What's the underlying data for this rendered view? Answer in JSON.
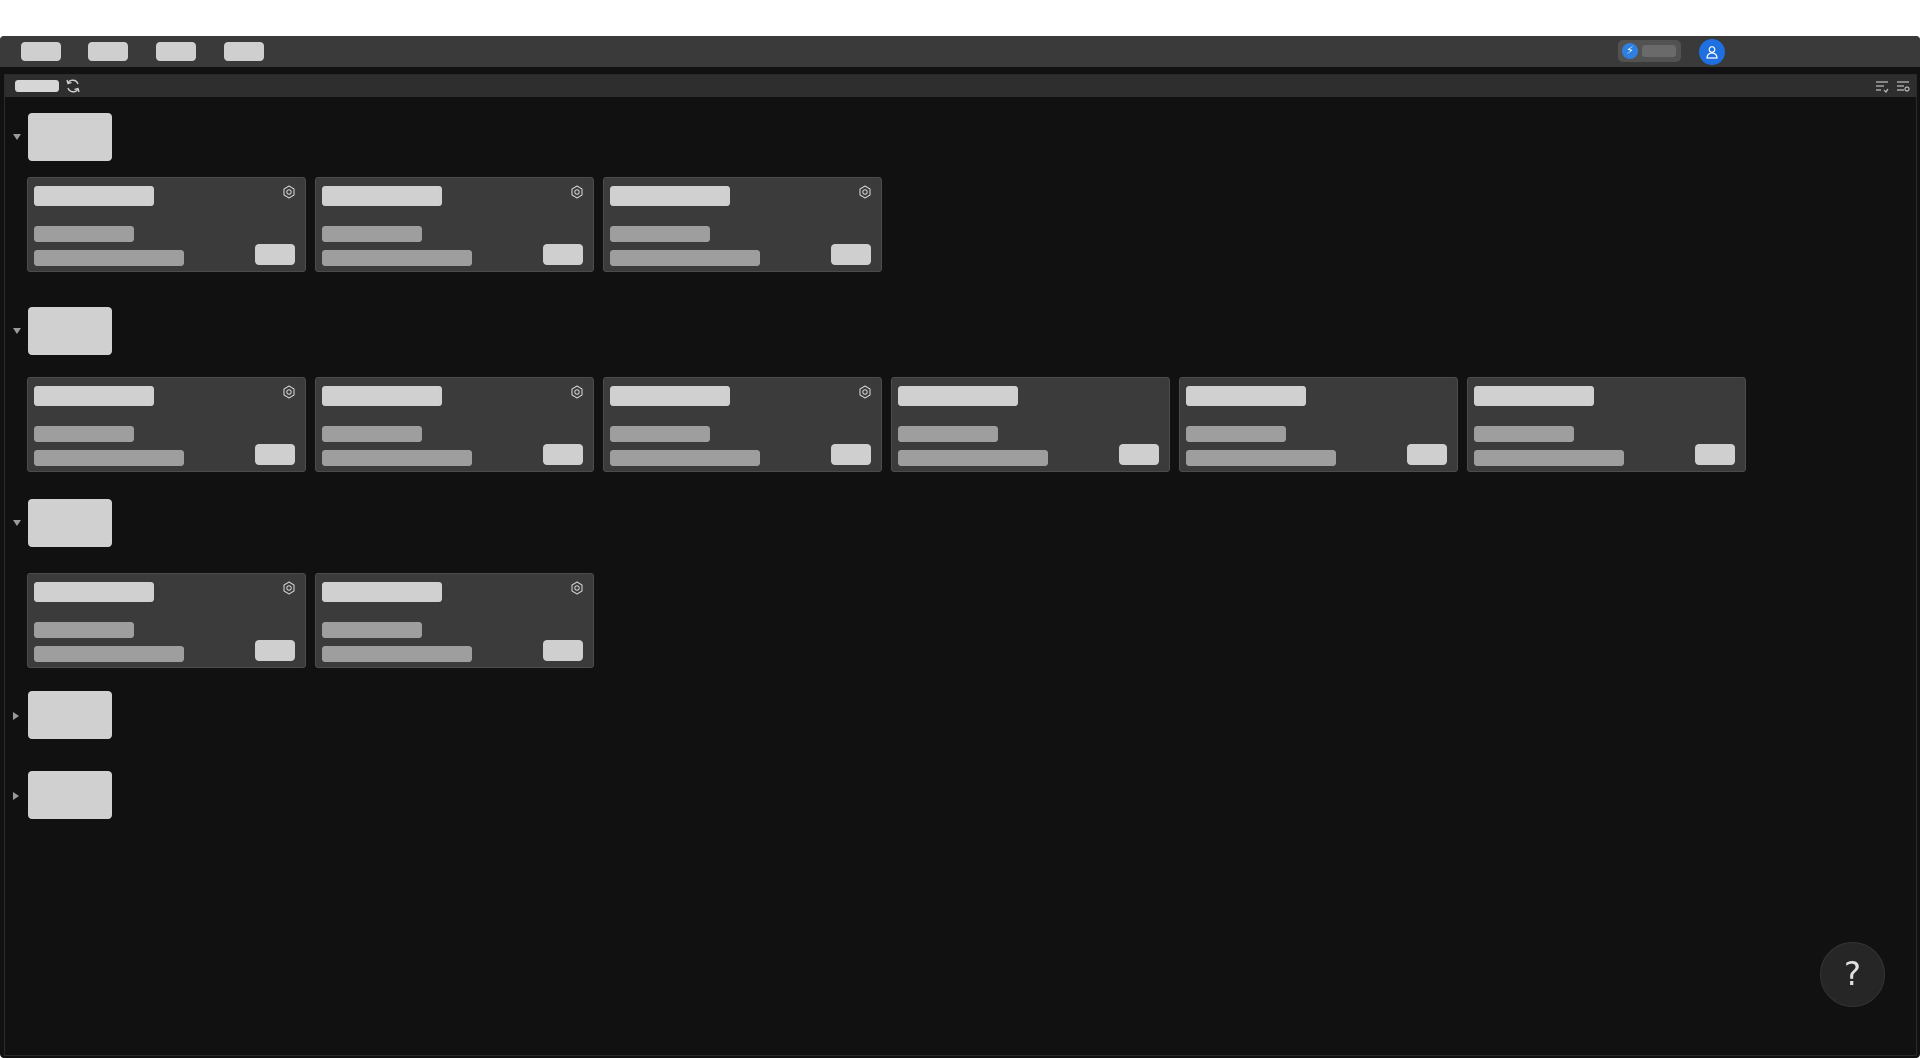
{
  "topbar": {
    "nav_items": [
      "",
      "",
      "",
      ""
    ],
    "speed_icon_name": "speed-icon",
    "avatar_icon_name": "user-icon",
    "accent_color": "#1f6fe0"
  },
  "subbar": {
    "breadcrumb": "",
    "icons": [
      "refresh-icon",
      "filter-list-icon",
      "filter-settings-icon"
    ]
  },
  "groups": [
    {
      "expanded": true,
      "label": "",
      "cards": [
        {
          "title": "",
          "subtitle": "",
          "desc": "",
          "button": "",
          "has_gear": true
        },
        {
          "title": "",
          "subtitle": "",
          "desc": "",
          "button": "",
          "has_gear": true
        },
        {
          "title": "",
          "subtitle": "",
          "desc": "",
          "button": "",
          "has_gear": true
        }
      ]
    },
    {
      "expanded": true,
      "label": "",
      "cards": [
        {
          "title": "",
          "subtitle": "",
          "desc": "",
          "button": "",
          "has_gear": true
        },
        {
          "title": "",
          "subtitle": "",
          "desc": "",
          "button": "",
          "has_gear": true
        },
        {
          "title": "",
          "subtitle": "",
          "desc": "",
          "button": "",
          "has_gear": true
        },
        {
          "title": "",
          "subtitle": "",
          "desc": "",
          "button": "",
          "has_gear": false
        },
        {
          "title": "",
          "subtitle": "",
          "desc": "",
          "button": "",
          "has_gear": false
        },
        {
          "title": "",
          "subtitle": "",
          "desc": "",
          "button": "",
          "has_gear": false
        }
      ]
    },
    {
      "expanded": true,
      "label": "",
      "cards": [
        {
          "title": "",
          "subtitle": "",
          "desc": "",
          "button": "",
          "has_gear": true
        },
        {
          "title": "",
          "subtitle": "",
          "desc": "",
          "button": "",
          "has_gear": true
        }
      ]
    },
    {
      "expanded": false,
      "label": "",
      "cards": []
    },
    {
      "expanded": false,
      "label": "",
      "cards": []
    }
  ],
  "help": {
    "label": "?"
  }
}
